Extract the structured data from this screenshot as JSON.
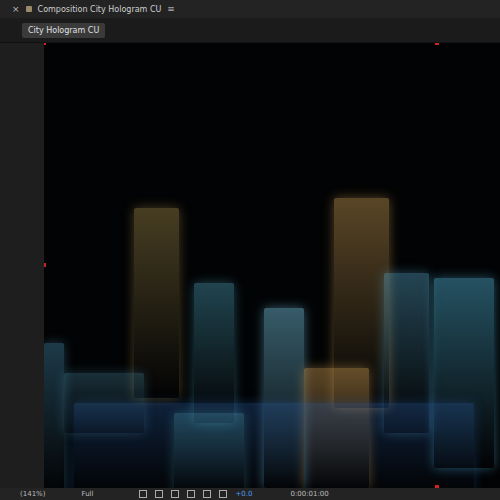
{
  "window": {
    "title": "Composition City Hologram CU",
    "close": "×",
    "menu": "≡"
  },
  "tabs": [
    {
      "label": "City Hologram CU",
      "selected": true
    }
  ],
  "toolbar": {
    "zoom": "(141%)",
    "resolution": "Full",
    "exposure": "+0.0",
    "timecode": "0:00:01:00"
  }
}
